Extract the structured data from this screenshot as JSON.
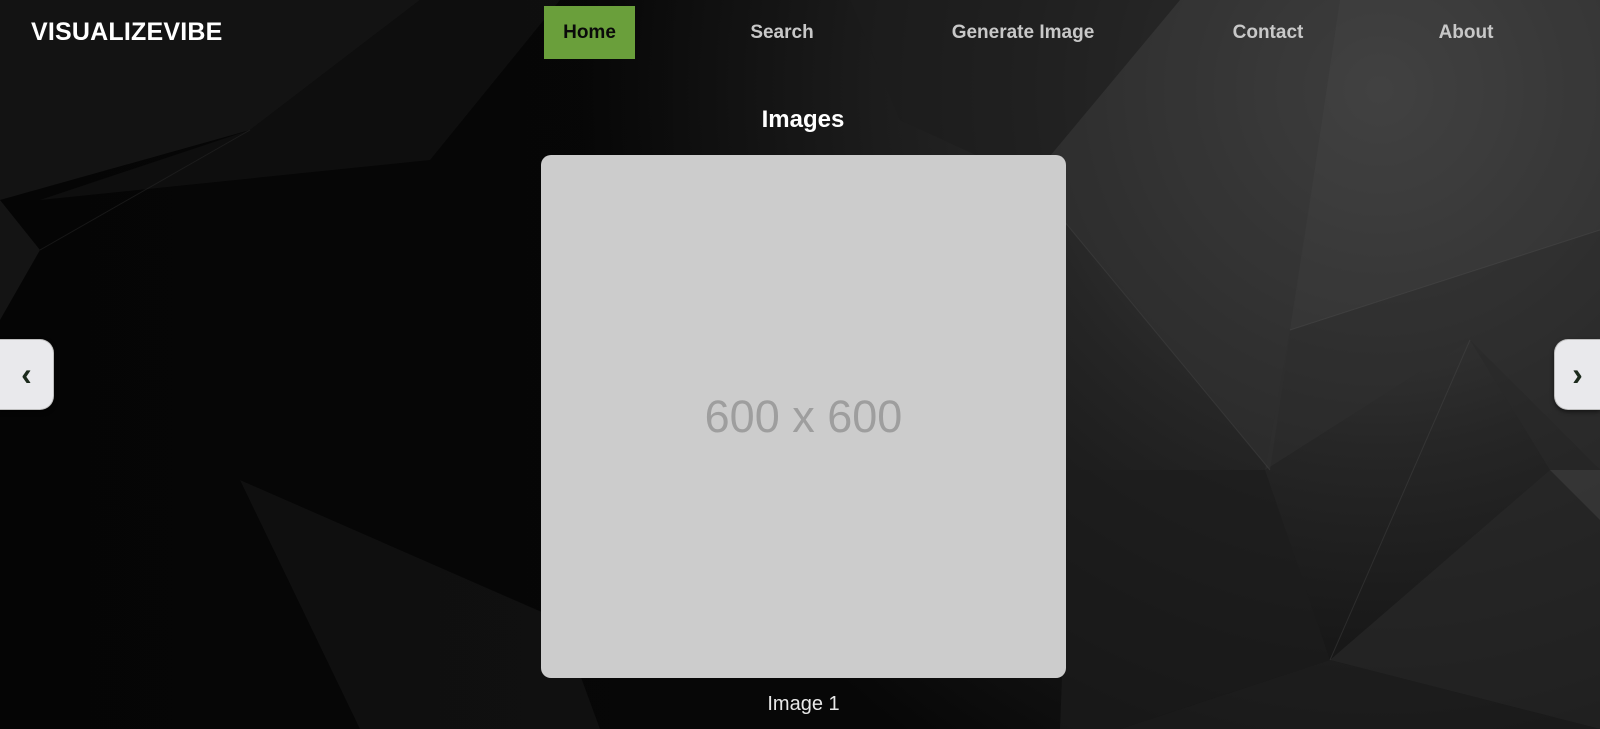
{
  "brand": "VISUALIZEVIBE",
  "nav": {
    "home": "Home",
    "search": "Search",
    "generate": "Generate Image",
    "contact": "Contact",
    "about": "About"
  },
  "main": {
    "title": "Images",
    "placeholder": "600 x 600",
    "caption": "Image 1"
  },
  "carousel": {
    "prev_icon": "‹",
    "next_icon": "›"
  },
  "colors": {
    "accent": "#6a9f3b",
    "background": "#0a0a0a",
    "placeholder_bg": "#cccccc"
  }
}
